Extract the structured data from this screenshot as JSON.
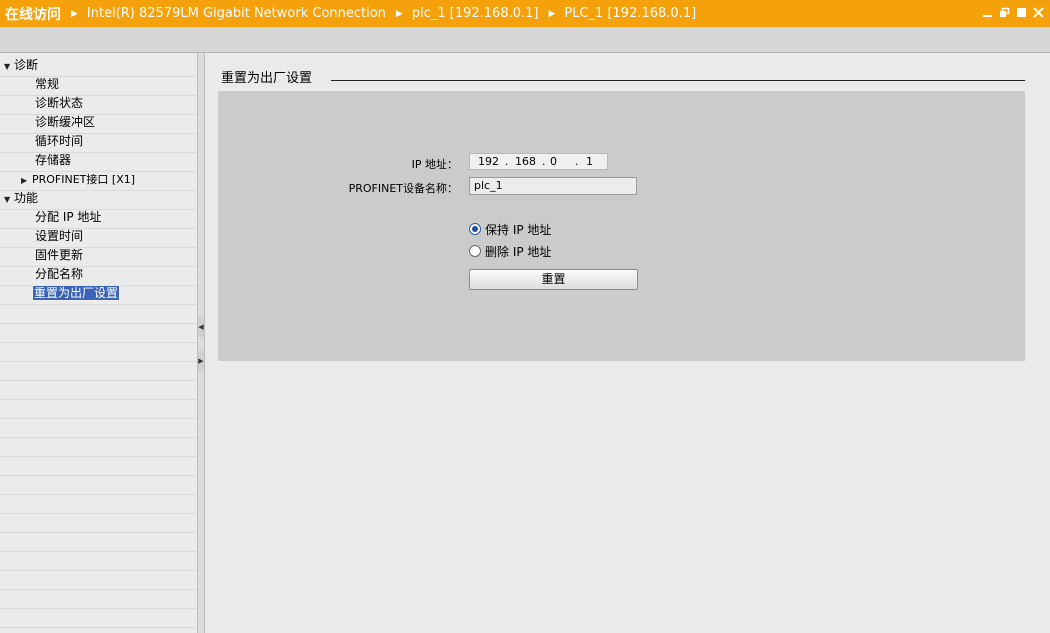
{
  "breadcrumb": {
    "root": "在线访问",
    "items": [
      "Intel(R) 82579LM Gigabit Network Connection",
      "plc_1 [192.168.0.1]",
      "PLC_1 [192.168.0.1]"
    ]
  },
  "window_buttons": [
    "minimize-icon",
    "restore-icon",
    "maximize-icon",
    "close-icon"
  ],
  "tree": {
    "diagnostics": {
      "label": "诊断",
      "items": [
        "常规",
        "诊断状态",
        "诊断缓冲区",
        "循环时间",
        "存储器"
      ],
      "profinet": "PROFINET接口 [X1]"
    },
    "functions": {
      "label": "功能",
      "items": [
        "分配 IP 地址",
        "设置时间",
        "固件更新",
        "分配名称",
        "重置为出厂设置"
      ],
      "selected": "重置为出厂设置"
    }
  },
  "main": {
    "section_title": "重置为出厂设置",
    "ip_label": "IP 地址：",
    "ip_octets": [
      "192",
      "168",
      "0",
      "1"
    ],
    "ip_separator": ".",
    "name_label": "PROFINET设备名称：",
    "name_value": "plc_1",
    "radio_keep": "保持 IP 地址",
    "radio_delete": "删除 IP 地址",
    "selected_option": "keep",
    "reset_button": "重置"
  },
  "colors": {
    "title_bar": "#f5a10c",
    "selection": "#3a63b8",
    "panel": "#cbcbcb"
  }
}
